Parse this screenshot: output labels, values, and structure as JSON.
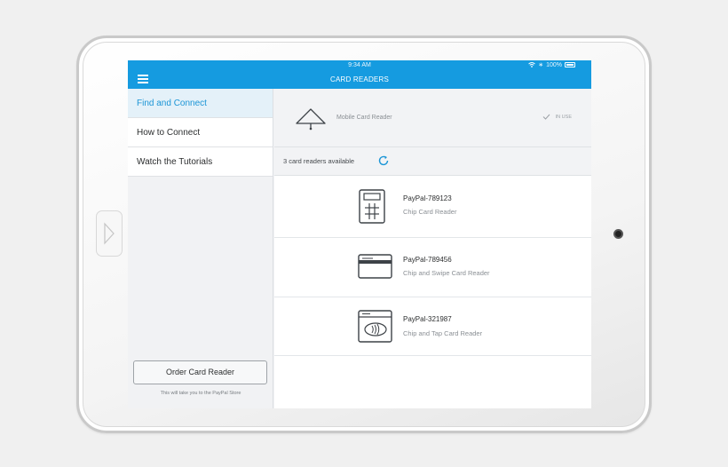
{
  "status_bar": {
    "time": "9:34 AM",
    "battery": "100%"
  },
  "app_bar": {
    "title": "CARD READERS",
    "menu_icon": "hamburger-icon"
  },
  "sidebar": {
    "items": [
      {
        "label": "Find and Connect",
        "active": true
      },
      {
        "label": "How to Connect",
        "active": false
      },
      {
        "label": "Watch the Tutorials",
        "active": false
      }
    ],
    "order_button": "Order Card Reader",
    "order_note": "This will take you to the PayPal Store"
  },
  "main": {
    "mobile_reader": {
      "label": "Mobile Card Reader",
      "status": "IN USE",
      "icon": "mobile-card-reader-icon"
    },
    "available_text": "3 card readers available",
    "readers": [
      {
        "name": "PayPal-789123",
        "type": "Chip Card Reader",
        "icon": "chip-reader-icon"
      },
      {
        "name": "PayPal-789456",
        "type": "Chip and Swipe Card Reader",
        "icon": "swipe-reader-icon"
      },
      {
        "name": "PayPal-321987",
        "type": "Chip and Tap Card Reader",
        "icon": "tap-reader-icon"
      }
    ]
  },
  "colors": {
    "accent": "#159be0",
    "active_item_bg": "#e4f1f9",
    "active_item_text": "#1b95d6"
  }
}
